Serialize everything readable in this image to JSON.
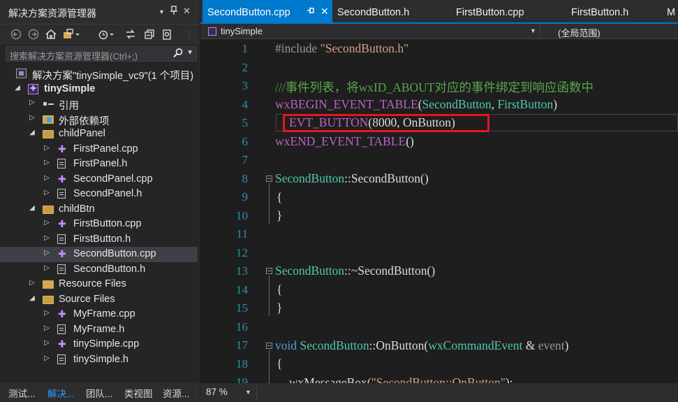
{
  "explorer": {
    "title": "解决方案资源管理器",
    "title_controls": {
      "dropdown": "▼",
      "pin": "📌",
      "close": "✕"
    },
    "toolbar_icons": [
      "back-icon",
      "forward-icon",
      "home-icon",
      "switch-views-icon",
      "history-icon",
      "sync-icon",
      "collapse-all-icon",
      "properties-icon"
    ],
    "search_placeholder": "搜索解决方案资源管理器(Ctrl+;)",
    "tree": [
      {
        "label": "解决方案\"tinySimple_vc9\"(1 个项目)",
        "icon": "solution-icon",
        "indent": 0,
        "arrow": "",
        "bold": false
      },
      {
        "label": "tinySimple",
        "icon": "project-icon",
        "indent": 1,
        "arrow": "◢",
        "bold": true
      },
      {
        "label": "引用",
        "icon": "references-icon",
        "indent": 2,
        "arrow": "▷",
        "bold": false
      },
      {
        "label": "外部依赖项",
        "icon": "external-deps-icon",
        "indent": 2,
        "arrow": "▷",
        "bold": false
      },
      {
        "label": "childPanel",
        "icon": "folder-open-icon",
        "indent": 2,
        "arrow": "◢",
        "bold": false
      },
      {
        "label": "FirstPanel.cpp",
        "icon": "cpp-file-icon",
        "indent": 3,
        "arrow": "▷",
        "bold": false
      },
      {
        "label": "FirstPanel.h",
        "icon": "header-file-icon",
        "indent": 3,
        "arrow": "▷",
        "bold": false
      },
      {
        "label": "SecondPanel.cpp",
        "icon": "cpp-file-icon",
        "indent": 3,
        "arrow": "▷",
        "bold": false
      },
      {
        "label": "SecondPanel.h",
        "icon": "header-file-icon",
        "indent": 3,
        "arrow": "▷",
        "bold": false
      },
      {
        "label": "childBtn",
        "icon": "folder-open-icon",
        "indent": 2,
        "arrow": "◢",
        "bold": false
      },
      {
        "label": "FirstButton.cpp",
        "icon": "cpp-file-icon",
        "indent": 3,
        "arrow": "▷",
        "bold": false
      },
      {
        "label": "FirstButton.h",
        "icon": "header-file-icon",
        "indent": 3,
        "arrow": "▷",
        "bold": false
      },
      {
        "label": "SecondButton.cpp",
        "icon": "cpp-file-icon",
        "indent": 3,
        "arrow": "▷",
        "bold": false,
        "selected": true
      },
      {
        "label": "SecondButton.h",
        "icon": "header-file-icon",
        "indent": 3,
        "arrow": "▷",
        "bold": false
      },
      {
        "label": "Resource Files",
        "icon": "folder-icon",
        "indent": 2,
        "arrow": "▷",
        "bold": false
      },
      {
        "label": "Source Files",
        "icon": "folder-open-icon",
        "indent": 2,
        "arrow": "◢",
        "bold": false
      },
      {
        "label": "MyFrame.cpp",
        "icon": "cpp-file-icon",
        "indent": 3,
        "arrow": "▷",
        "bold": false
      },
      {
        "label": "MyFrame.h",
        "icon": "header-file-icon",
        "indent": 3,
        "arrow": "▷",
        "bold": false
      },
      {
        "label": "tinySimple.cpp",
        "icon": "cpp-file-icon",
        "indent": 3,
        "arrow": "▷",
        "bold": false
      },
      {
        "label": "tinySimple.h",
        "icon": "header-file-icon",
        "indent": 3,
        "arrow": "▷",
        "bold": false
      }
    ],
    "bottom_tabs": [
      {
        "label": "测试...",
        "active": false
      },
      {
        "label": "解决...",
        "active": true
      },
      {
        "label": "团队...",
        "active": false
      },
      {
        "label": "类视图",
        "active": false
      },
      {
        "label": "资源...",
        "active": false
      }
    ]
  },
  "editor": {
    "tabs": [
      {
        "label": "SecondButton.cpp",
        "active": true,
        "pin": "⊸",
        "close": "✕"
      },
      {
        "label": "SecondButton.h",
        "active": false
      },
      {
        "label": "FirstButton.cpp",
        "active": false
      },
      {
        "label": "FirstButton.h",
        "active": false
      },
      {
        "label": "M",
        "active": false
      }
    ],
    "nav": {
      "scope": "tinySimple",
      "global": "(全局范围)"
    },
    "zoom": "87 %",
    "line_numbers": [
      "1",
      "2",
      "3",
      "4",
      "5",
      "6",
      "7",
      "8",
      "9",
      "10",
      "11",
      "12",
      "13",
      "14",
      "15",
      "16",
      "17",
      "18",
      "19"
    ],
    "code": {
      "l1_a": "#include ",
      "l1_b": "\"SecondButton.h\"",
      "l3": "///事件列表，将wxID_ABOUT对应的事件绑定到响应函数中",
      "l4_a": "wxBEGIN_EVENT_TABLE",
      "l4_b": "(",
      "l4_c": "SecondButton",
      "l4_d": ", ",
      "l4_e": "FirstButton",
      "l4_f": ")",
      "l5_a": "EVT_BUTTON",
      "l5_b": "(8000, OnButton)",
      "l6_a": "wxEND_EVENT_TABLE",
      "l6_b": "()",
      "l8_a": "SecondButton",
      "l8_b": "::SecondButton()",
      "l9": "{",
      "l10": "}",
      "l13_a": "SecondButton",
      "l13_b": "::~SecondButton()",
      "l14": "{",
      "l15": "}",
      "l17_a": "void ",
      "l17_b": "SecondButton",
      "l17_c": "::OnButton(",
      "l17_d": "wxCommandEvent",
      "l17_e": " & ",
      "l17_f": "event",
      "l17_g": ")",
      "l18": "{",
      "l19_a": "wxMessageBox(",
      "l19_b": "\"SecondButton::OnButton\"",
      "l19_c": ");"
    }
  },
  "colors": {
    "accent": "#007acc",
    "highlight_box": "#e8151b",
    "line_number": "#2b91af",
    "comment": "#57a64a",
    "class_name": "#4ec9b0",
    "macro": "#bd63c5",
    "string": "#d69d85",
    "keyword": "#569cd6"
  }
}
